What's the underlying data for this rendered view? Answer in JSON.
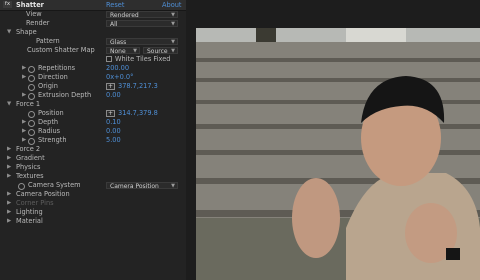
{
  "effect": {
    "fx_badge": "fx",
    "name": "Shatter",
    "reset": "Reset",
    "about": "About"
  },
  "view": {
    "label": "View",
    "value": "Rendered"
  },
  "render": {
    "label": "Render",
    "value": "All"
  },
  "shape": {
    "label": "Shape",
    "pattern": {
      "label": "Pattern",
      "value": "Glass"
    },
    "custom_map": {
      "label": "Custom Shatter Map",
      "value": "None",
      "source": "Source"
    },
    "white_tiles": {
      "label": "White Tiles Fixed"
    },
    "repetitions": {
      "label": "Repetitions",
      "value": "200.00"
    },
    "direction": {
      "label": "Direction",
      "value": "0x+0.0°"
    },
    "origin": {
      "label": "Origin",
      "value": "378.7,217.3"
    },
    "extrusion": {
      "label": "Extrusion Depth",
      "value": "0.00"
    }
  },
  "force1": {
    "label": "Force 1",
    "position": {
      "label": "Position",
      "value": "314.7,379.8"
    },
    "depth": {
      "label": "Depth",
      "value": "0.10"
    },
    "radius": {
      "label": "Radius",
      "value": "0.00"
    },
    "strength": {
      "label": "Strength",
      "value": "5.00"
    }
  },
  "groups": {
    "force2": "Force 2",
    "gradient": "Gradient",
    "physics": "Physics",
    "textures": "Textures"
  },
  "camera_system": {
    "label": "Camera System",
    "value": "Camera Position"
  },
  "groups2": {
    "camera_position": "Camera Position",
    "corner_pins": "Corner Pins",
    "lighting": "Lighting",
    "material": "Material"
  },
  "colors": {
    "accent": "#4f8fd6",
    "panel": "#232323",
    "text": "#b9b9b9"
  },
  "icons": {
    "twirl": "triangle-icon",
    "stopwatch": "stopwatch-icon",
    "target": "crosshair-icon",
    "dropdown": "chevron-down-icon"
  }
}
